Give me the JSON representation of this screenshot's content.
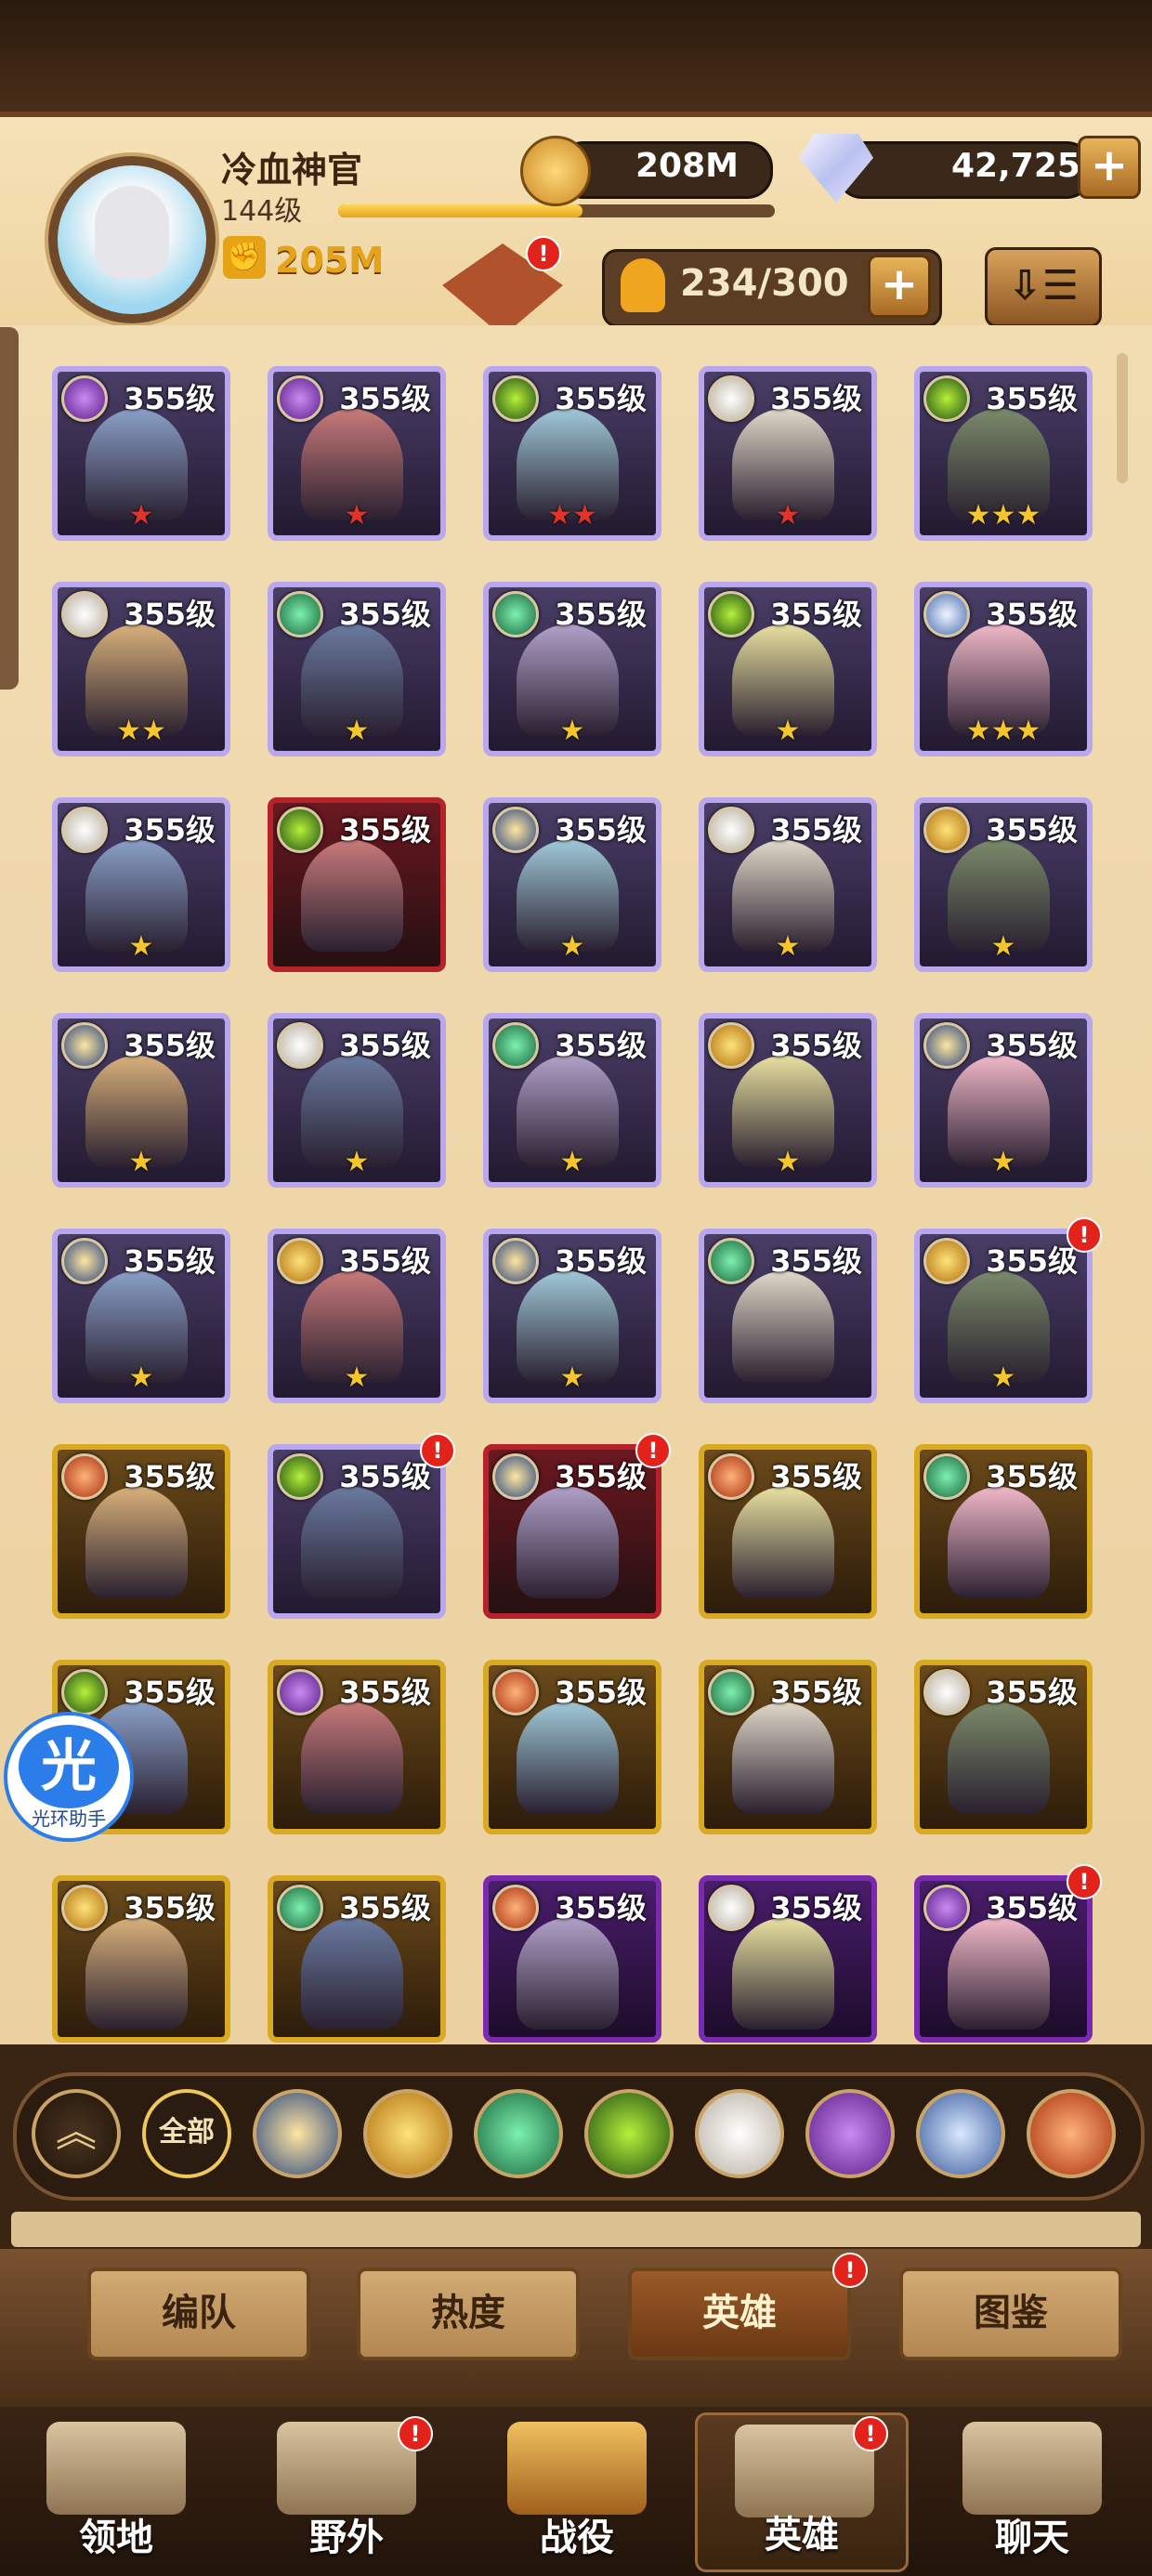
{
  "player": {
    "name": "冷血神官",
    "level": "144级",
    "xp_fraction": 0.56,
    "power": "205M"
  },
  "resources": {
    "gold": "208M",
    "diamonds": "42,725"
  },
  "roster": {
    "count": "234/300",
    "badge": "!"
  },
  "hero_cards": [
    {
      "level": "355级",
      "frame": "silver",
      "stars": "★",
      "star_color": "red",
      "faction": "purple"
    },
    {
      "level": "355级",
      "frame": "silver",
      "stars": "★",
      "star_color": "red",
      "faction": "purple"
    },
    {
      "level": "355级",
      "frame": "silver",
      "stars": "★★",
      "star_color": "red",
      "faction": "green-eye"
    },
    {
      "level": "355级",
      "frame": "silver",
      "stars": "★",
      "star_color": "red",
      "faction": "white"
    },
    {
      "level": "355级",
      "frame": "silver",
      "stars": "★★★",
      "star_color": "gold",
      "faction": "green-eye"
    },
    {
      "level": "355级",
      "frame": "silver",
      "stars": "★★",
      "star_color": "gold",
      "faction": "white"
    },
    {
      "level": "355级",
      "frame": "silver",
      "stars": "★",
      "star_color": "gold",
      "faction": "green"
    },
    {
      "level": "355级",
      "frame": "silver",
      "stars": "★",
      "star_color": "gold",
      "faction": "green"
    },
    {
      "level": "355级",
      "frame": "silver",
      "stars": "★",
      "star_color": "gold",
      "faction": "green-eye"
    },
    {
      "level": "355级",
      "frame": "silver",
      "stars": "★★★",
      "star_color": "gold",
      "faction": "blue-white"
    },
    {
      "level": "355级",
      "frame": "silver",
      "stars": "★",
      "star_color": "gold",
      "faction": "white"
    },
    {
      "level": "355级",
      "frame": "red",
      "stars": "",
      "star_color": "gold",
      "faction": "green-eye"
    },
    {
      "level": "355级",
      "frame": "silver",
      "stars": "★",
      "star_color": "gold",
      "faction": "blue"
    },
    {
      "level": "355级",
      "frame": "silver",
      "stars": "★",
      "star_color": "gold",
      "faction": "white"
    },
    {
      "level": "355级",
      "frame": "silver",
      "stars": "★",
      "star_color": "gold",
      "faction": "gold"
    },
    {
      "level": "355级",
      "frame": "silver",
      "stars": "★",
      "star_color": "gold",
      "faction": "blue"
    },
    {
      "level": "355级",
      "frame": "silver",
      "stars": "★",
      "star_color": "gold",
      "faction": "white"
    },
    {
      "level": "355级",
      "frame": "silver",
      "stars": "★",
      "star_color": "gold",
      "faction": "green"
    },
    {
      "level": "355级",
      "frame": "silver",
      "stars": "★",
      "star_color": "gold",
      "faction": "gold"
    },
    {
      "level": "355级",
      "frame": "silver",
      "stars": "★",
      "star_color": "gold",
      "faction": "blue"
    },
    {
      "level": "355级",
      "frame": "silver",
      "stars": "★",
      "star_color": "gold",
      "faction": "blue"
    },
    {
      "level": "355级",
      "frame": "silver",
      "stars": "★",
      "star_color": "gold",
      "faction": "gold"
    },
    {
      "level": "355级",
      "frame": "silver",
      "stars": "★",
      "star_color": "gold",
      "faction": "blue"
    },
    {
      "level": "355级",
      "frame": "silver",
      "stars": "",
      "star_color": "gold",
      "faction": "green"
    },
    {
      "level": "355级",
      "frame": "silver",
      "stars": "★",
      "star_color": "gold",
      "faction": "gold",
      "badge": "!"
    },
    {
      "level": "355级",
      "frame": "gold",
      "stars": "",
      "star_color": "gold",
      "faction": "red"
    },
    {
      "level": "355级",
      "frame": "silver",
      "stars": "",
      "star_color": "gold",
      "faction": "green-eye",
      "badge": "!"
    },
    {
      "level": "355级",
      "frame": "red",
      "stars": "",
      "star_color": "gold",
      "faction": "blue",
      "badge": "!"
    },
    {
      "level": "355级",
      "frame": "gold",
      "stars": "",
      "star_color": "gold",
      "faction": "red"
    },
    {
      "level": "355级",
      "frame": "gold",
      "stars": "",
      "star_color": "gold",
      "faction": "green"
    },
    {
      "level": "355级",
      "frame": "gold",
      "stars": "",
      "star_color": "gold",
      "faction": "green-eye"
    },
    {
      "level": "355级",
      "frame": "gold",
      "stars": "",
      "star_color": "gold",
      "faction": "purple"
    },
    {
      "level": "355级",
      "frame": "gold",
      "stars": "",
      "star_color": "gold",
      "faction": "red"
    },
    {
      "level": "355级",
      "frame": "gold",
      "stars": "",
      "star_color": "gold",
      "faction": "green"
    },
    {
      "level": "355级",
      "frame": "gold",
      "stars": "",
      "star_color": "gold",
      "faction": "white"
    },
    {
      "level": "355级",
      "frame": "gold",
      "stars": "",
      "star_color": "gold",
      "faction": "gold"
    },
    {
      "level": "355级",
      "frame": "gold",
      "stars": "",
      "star_color": "gold",
      "faction": "green"
    },
    {
      "level": "355级",
      "frame": "purple",
      "stars": "",
      "star_color": "gold",
      "faction": "red"
    },
    {
      "level": "355级",
      "frame": "purple",
      "stars": "",
      "star_color": "gold",
      "faction": "white"
    },
    {
      "level": "355级",
      "frame": "purple",
      "stars": "",
      "star_color": "gold",
      "faction": "purple",
      "badge": "!"
    }
  ],
  "floating_assistant": {
    "glyph": "光",
    "label": "光环助手"
  },
  "faction_filters": [
    {
      "name": "rank-up-icon"
    },
    {
      "name": "all",
      "label": "全部"
    },
    {
      "name": "lightbearer-icon"
    },
    {
      "name": "mauler-icon"
    },
    {
      "name": "wilder-icon"
    },
    {
      "name": "graveborn-icon"
    },
    {
      "name": "celestial-icon"
    },
    {
      "name": "hypogean-icon"
    },
    {
      "name": "dimensional-icon"
    },
    {
      "name": "flame-icon"
    }
  ],
  "sub_tabs": [
    {
      "label": "编队",
      "active": false
    },
    {
      "label": "热度",
      "active": false
    },
    {
      "label": "英雄",
      "active": true,
      "badge": "!"
    },
    {
      "label": "图鉴",
      "active": false
    }
  ],
  "bottom_nav": [
    {
      "label": "领地",
      "icon": "castle-icon",
      "active": false
    },
    {
      "label": "野外",
      "icon": "map-scroll-icon",
      "active": false,
      "badge": "!"
    },
    {
      "label": "战役",
      "icon": "battle-sword-icon",
      "active": false
    },
    {
      "label": "英雄",
      "icon": "hero-helmet-icon",
      "active": true,
      "badge": "!"
    },
    {
      "label": "聊天",
      "icon": "chat-bubble-icon",
      "active": false
    }
  ],
  "colors": {
    "gold_accent": "#e6a315",
    "badge_red": "#e3231b",
    "panel_bg": "#f1dcb2"
  }
}
